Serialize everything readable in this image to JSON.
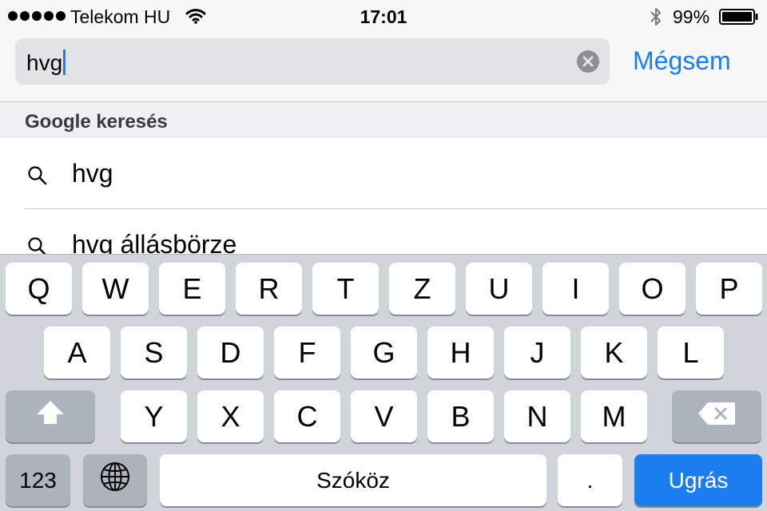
{
  "status_bar": {
    "carrier": "Telekom HU",
    "time": "17:01",
    "battery": "99%"
  },
  "search": {
    "query": "hvg",
    "cancel_label": "Mégsem"
  },
  "section": {
    "title": "Google keresés"
  },
  "suggestions": [
    {
      "text": "hvg"
    },
    {
      "text": "hvg állásbörze"
    }
  ],
  "keyboard": {
    "row1": [
      "Q",
      "W",
      "E",
      "R",
      "T",
      "Z",
      "U",
      "I",
      "O",
      "P"
    ],
    "row2": [
      "A",
      "S",
      "D",
      "F",
      "G",
      "H",
      "J",
      "K",
      "L"
    ],
    "row3": [
      "Y",
      "X",
      "C",
      "V",
      "B",
      "N",
      "M"
    ],
    "numbers_label": "123",
    "space_label": "Szóköz",
    "period_label": ".",
    "go_label": "Ugrás"
  },
  "colors": {
    "accent": "#1a7ef0",
    "keyboard_bg": "#d1d5db"
  }
}
